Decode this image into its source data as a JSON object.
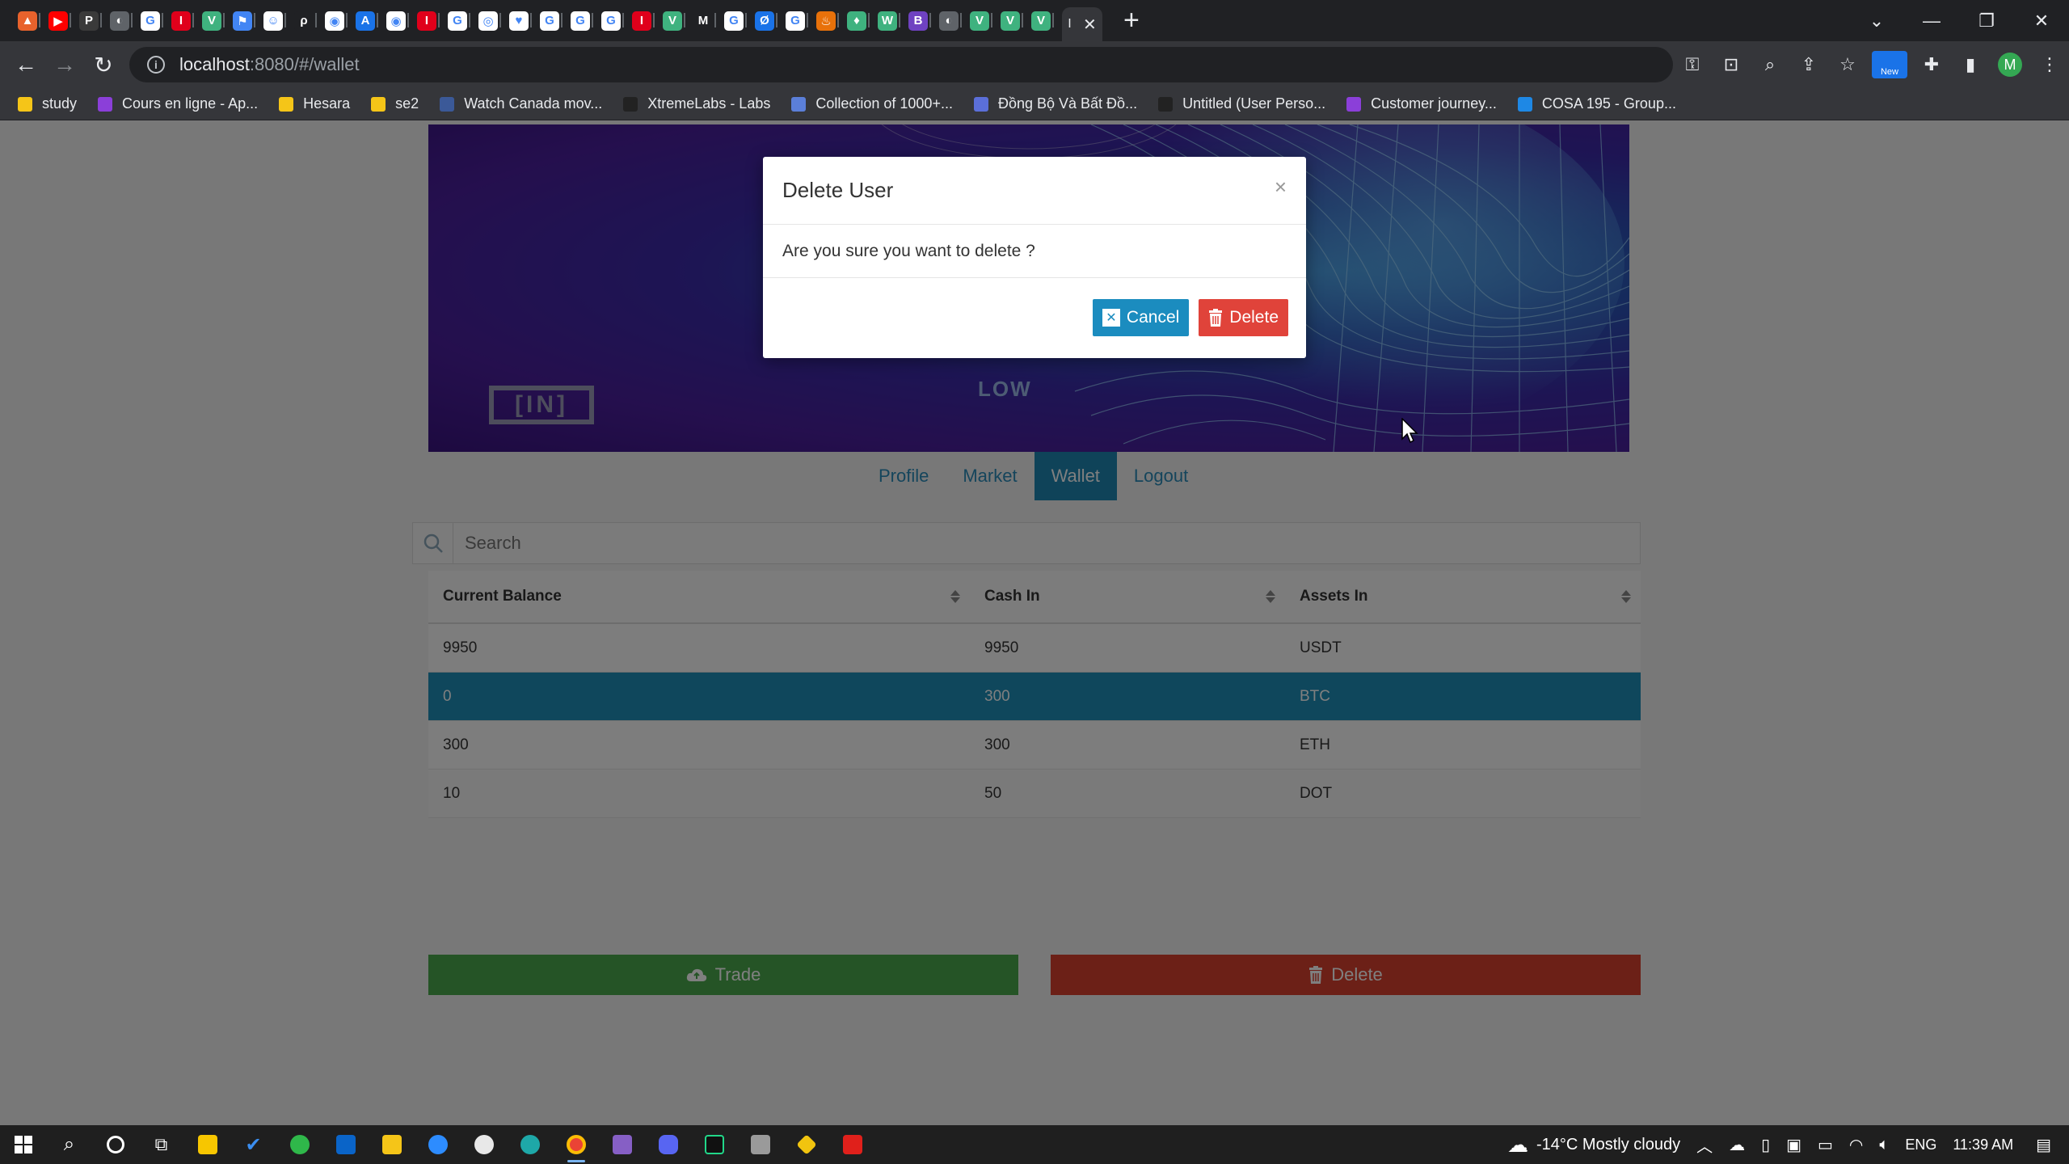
{
  "browser": {
    "url_host": "localhost",
    "url_path": ":8080/#/wallet",
    "new_badge": "New",
    "profile_initial": "M",
    "tabs": [
      {
        "color": "#e8622c",
        "glyph": "▲"
      },
      {
        "color": "#ff0000",
        "glyph": "▶"
      },
      {
        "color": "#3a3a3a",
        "glyph": "P"
      },
      {
        "color": "#5f6368",
        "glyph": "◐"
      },
      {
        "color": "#ffffff",
        "glyph": "G"
      },
      {
        "color": "#e0001b",
        "glyph": "I"
      },
      {
        "color": "#3fb27f",
        "glyph": "V"
      },
      {
        "color": "#4285f4",
        "glyph": "⚑"
      },
      {
        "color": "#ffffff",
        "glyph": "☺"
      },
      {
        "color": "#202124",
        "glyph": "ρ"
      },
      {
        "color": "#ffffff",
        "glyph": "◉"
      },
      {
        "color": "#1a73e8",
        "glyph": "A"
      },
      {
        "color": "#ffffff",
        "glyph": "◉"
      },
      {
        "color": "#e0001b",
        "glyph": "I"
      },
      {
        "color": "#ffffff",
        "glyph": "G"
      },
      {
        "color": "#ffffff",
        "glyph": "◎"
      },
      {
        "color": "#ffffff",
        "glyph": "♥"
      },
      {
        "color": "#ffffff",
        "glyph": "G"
      },
      {
        "color": "#ffffff",
        "glyph": "G"
      },
      {
        "color": "#ffffff",
        "glyph": "G"
      },
      {
        "color": "#e0001b",
        "glyph": "I"
      },
      {
        "color": "#3fb27f",
        "glyph": "V"
      },
      {
        "color": "#202124",
        "glyph": "M"
      },
      {
        "color": "#ffffff",
        "glyph": "G"
      },
      {
        "color": "#1a73e8",
        "glyph": "Ø"
      },
      {
        "color": "#ffffff",
        "glyph": "G"
      },
      {
        "color": "#e8710a",
        "glyph": "♨"
      },
      {
        "color": "#3fb27f",
        "glyph": "♦"
      },
      {
        "color": "#3fb27f",
        "glyph": "W"
      },
      {
        "color": "#6f42c1",
        "glyph": "B"
      },
      {
        "color": "#5f6368",
        "glyph": "◐"
      },
      {
        "color": "#3fb27f",
        "glyph": "V"
      },
      {
        "color": "#3fb27f",
        "glyph": "V"
      },
      {
        "color": "#3fb27f",
        "glyph": "V"
      }
    ],
    "bookmarks": [
      {
        "label": "study",
        "color": "#f5c518"
      },
      {
        "label": "Cours en ligne - Ap...",
        "color": "#8b3fd9"
      },
      {
        "label": "Hesara",
        "color": "#f5c518"
      },
      {
        "label": "se2",
        "color": "#f5c518"
      },
      {
        "label": "Watch Canada mov...",
        "color": "#3b5998"
      },
      {
        "label": "XtremeLabs - Labs",
        "color": "#222222"
      },
      {
        "label": "Collection of 1000+...",
        "color": "#5b7fd9"
      },
      {
        "label": "Đồng Bộ Và Bất Đồ...",
        "color": "#5b6fd9"
      },
      {
        "label": "Untitled (User Perso...",
        "color": "#222222"
      },
      {
        "label": "Customer journey...",
        "color": "#8b3fd9"
      },
      {
        "label": "COSA 195 - Group...",
        "color": "#1e88e5"
      }
    ]
  },
  "hero": {
    "logo_text": "[IN]",
    "overlay_text": "LOW"
  },
  "nav": {
    "items": [
      "Profile",
      "Market",
      "Wallet",
      "Logout"
    ],
    "active": "Wallet"
  },
  "search": {
    "placeholder": "Search"
  },
  "table": {
    "headers": [
      "Current Balance",
      "Cash In",
      "Assets In"
    ],
    "rows": [
      [
        "9950",
        "9950",
        "USDT"
      ],
      [
        "0",
        "300",
        "BTC"
      ],
      [
        "300",
        "300",
        "ETH"
      ],
      [
        "10",
        "50",
        "DOT"
      ]
    ],
    "selected_row": 1
  },
  "actions": {
    "trade_label": "Trade",
    "delete_label": "Delete"
  },
  "modal": {
    "title": "Delete User",
    "close": "×",
    "body": "Are you sure you want to delete ?",
    "cancel_label": "Cancel",
    "delete_label": "Delete"
  },
  "taskbar": {
    "weather": "-14°C  Mostly cloudy",
    "lang": "ENG",
    "time": "11:39 AM"
  },
  "colors": {
    "accent": "#1e87b3",
    "trade": "#4aa84c",
    "danger": "#d9412f"
  }
}
